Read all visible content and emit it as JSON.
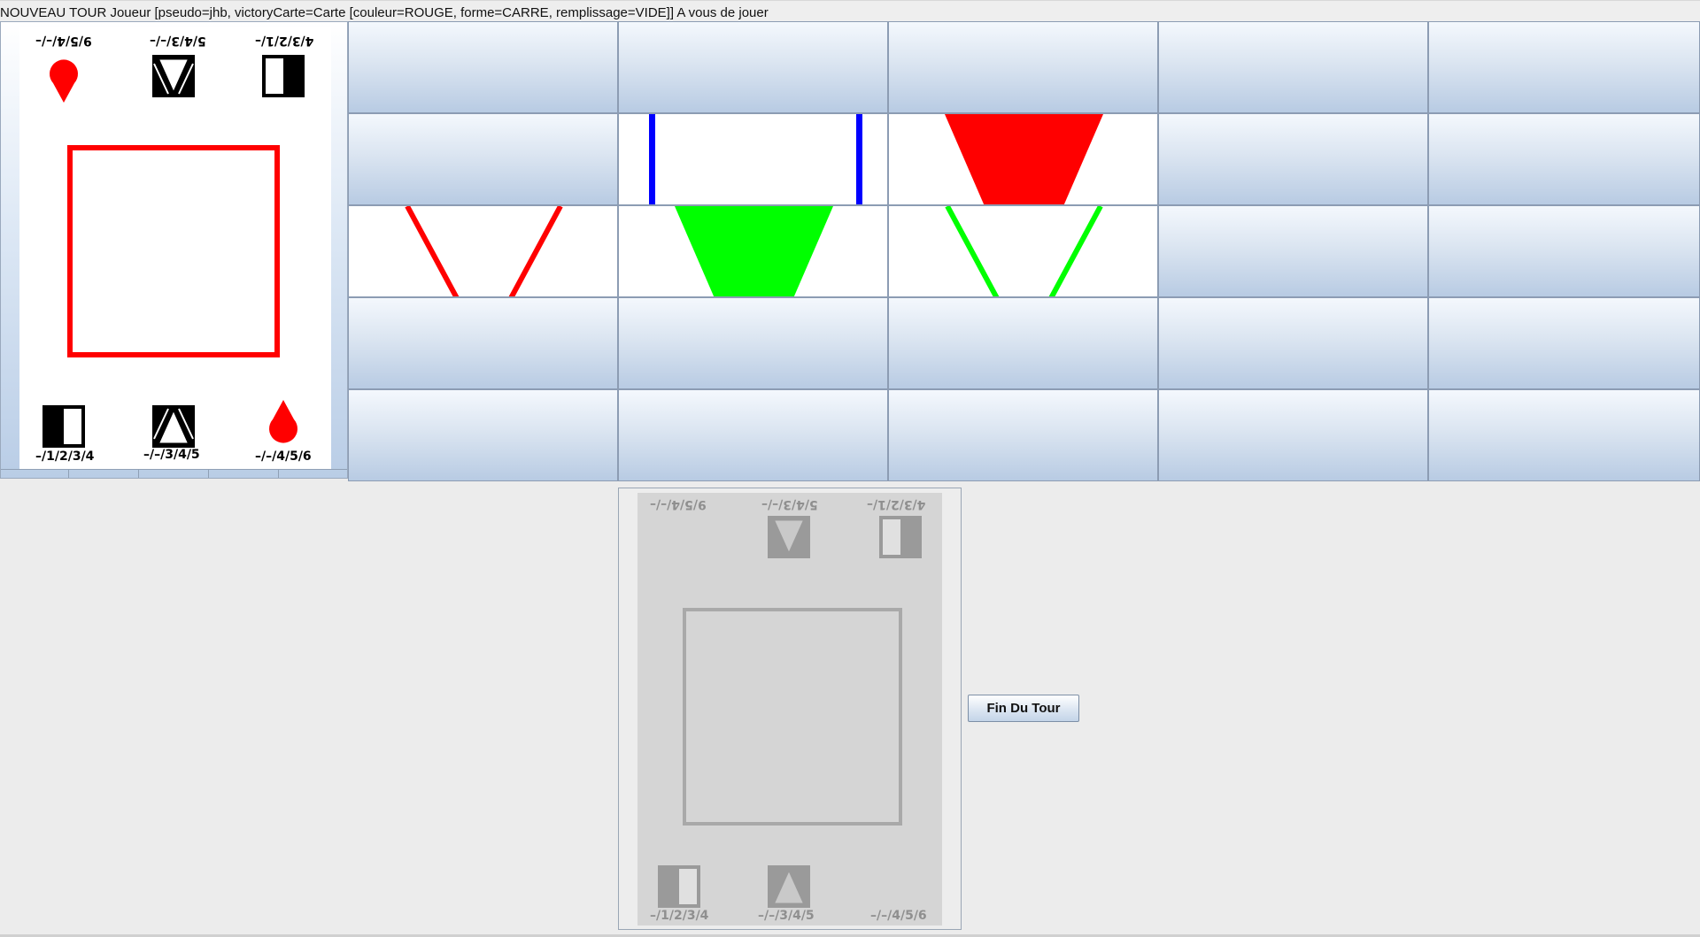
{
  "status": {
    "message": "NOUVEAU TOUR Joueur [pseudo=jhb, victoryCarte=Carte [couleur=ROUGE, forme=CARRE, remplissage=VIDE]] A vous de jouer"
  },
  "victory_card": {
    "color": "#ff0000",
    "shape": "square",
    "fill": "empty",
    "top_labels": [
      "9/5/4/–/–",
      "5/4/3/–/–",
      "4/3/2/1/–"
    ],
    "bottom_labels": [
      "–/1/2/3/4",
      "–/–/3/4/5",
      "–/–/4/5/6"
    ],
    "icons": [
      "drop-icon",
      "triangle-hatched-icon",
      "half-filled-rectangle-icon"
    ]
  },
  "board": {
    "rows": 5,
    "cols": 5,
    "played_cards": [
      {
        "row": 1,
        "col": 1,
        "shape": "rectangle",
        "color": "#0000ff",
        "fill": "empty"
      },
      {
        "row": 1,
        "col": 2,
        "shape": "triangle",
        "color": "#ff0000",
        "fill": "full"
      },
      {
        "row": 2,
        "col": 0,
        "shape": "triangle",
        "color": "#ff0000",
        "fill": "empty"
      },
      {
        "row": 2,
        "col": 1,
        "shape": "triangle",
        "color": "#00ff00",
        "fill": "full"
      },
      {
        "row": 2,
        "col": 2,
        "shape": "triangle",
        "color": "#00ff00",
        "fill": "empty"
      }
    ]
  },
  "hand_card": {
    "state": "disabled",
    "shape": "square",
    "fill": "empty",
    "top_labels": [
      "9/5/4/–/–",
      "5/4/3/–/–",
      "4/3/2/1/–"
    ],
    "bottom_labels": [
      "–/1/2/3/4",
      "–/–/3/4/5",
      "–/–/4/5/6"
    ]
  },
  "actions": {
    "end_turn_label": "Fin Du Tour"
  }
}
